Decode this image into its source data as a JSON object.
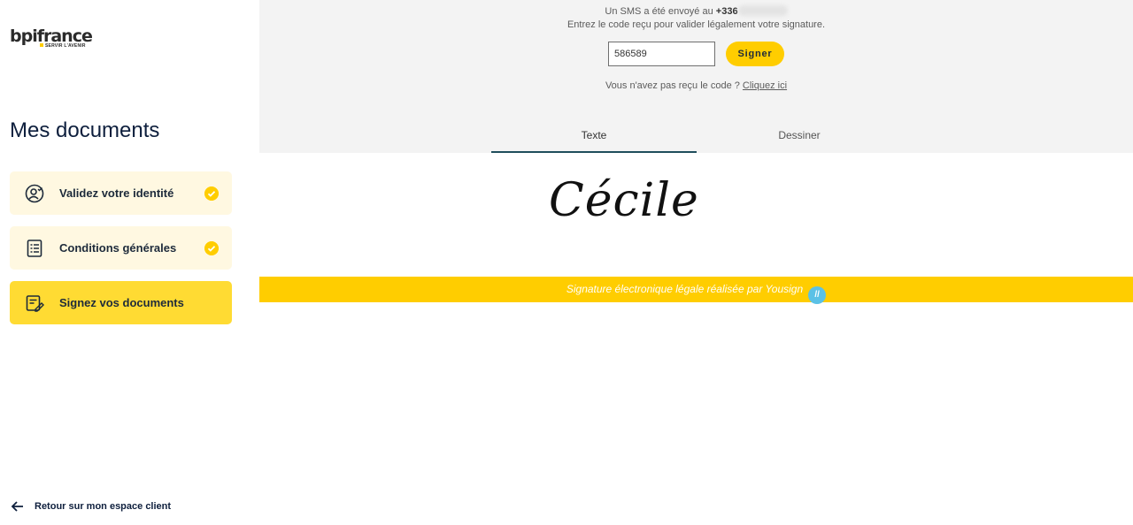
{
  "brand": {
    "name": "bpifrance",
    "tagline": "SERVIR L'AVENIR"
  },
  "sidebar": {
    "title": "Mes documents",
    "steps": [
      {
        "label": "Validez votre identité",
        "icon": "user-check-icon",
        "status": "done"
      },
      {
        "label": "Conditions générales",
        "icon": "document-list-icon",
        "status": "done"
      },
      {
        "label": "Signez vos documents",
        "icon": "document-sign-icon",
        "status": "active"
      }
    ],
    "back_label": "Retour sur mon espace client"
  },
  "sms": {
    "sent_prefix": "Un SMS a été envoyé au",
    "phone_prefix": "+336",
    "instruction": "Entrez le code reçu pour valider légalement votre signature.",
    "code_value": "586589",
    "sign_button": "Signer",
    "resend_text": "Vous n'avez pas reçu le code ?",
    "resend_link": "Cliquez ici"
  },
  "tabs": [
    {
      "label": "Texte",
      "selected": true
    },
    {
      "label": "Dessiner",
      "selected": false
    }
  ],
  "signature": {
    "name": "Cécile"
  },
  "footer_band": {
    "text": "Signature électronique légale réalisée par Yousign",
    "icon": "yousign-icon"
  },
  "colors": {
    "accent_yellow": "#ffcd00",
    "navy": "#0e1f3d",
    "tab_underline": "#1f4e5c"
  }
}
